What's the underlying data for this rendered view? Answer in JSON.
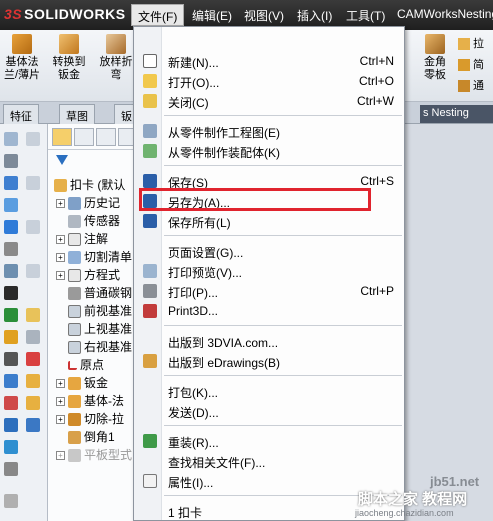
{
  "app": {
    "logo_text": "SOLIDWORKS"
  },
  "menubar": {
    "items": [
      {
        "label": "文件(F)"
      },
      {
        "label": "编辑(E)"
      },
      {
        "label": "视图(V)"
      },
      {
        "label": "插入(I)"
      },
      {
        "label": "工具(T)"
      },
      {
        "label": "CAMWorksNesting"
      }
    ]
  },
  "toolbar": {
    "buttons": [
      {
        "label_line1": "基体法",
        "label_line2": "兰/薄片",
        "icon": "base-flange-icon"
      },
      {
        "label_line1": "转换到",
        "label_line2": "钣金",
        "icon": "convert-sheetmetal-icon"
      },
      {
        "label_line1": "放样折",
        "label_line2": "弯",
        "icon": "lofted-bend-icon"
      }
    ],
    "right_buttons": [
      {
        "label_line1": "金角",
        "label_line2": "零板"
      },
      {
        "label": "拉"
      },
      {
        "label": "简"
      },
      {
        "label": "通"
      }
    ]
  },
  "tabs": {
    "items": [
      {
        "label": "特征"
      },
      {
        "label": "草图"
      },
      {
        "label": "钣"
      }
    ],
    "nesting_label": "s Nesting"
  },
  "tree": {
    "nodes": [
      {
        "label": "扣卡 (默认",
        "icon": "part-icon",
        "level": 0
      },
      {
        "label": "历史记",
        "icon": "history-icon",
        "level": 1
      },
      {
        "label": "传感器",
        "icon": "sensor-icon",
        "level": 1
      },
      {
        "label": "注解",
        "icon": "annotation-icon",
        "level": 1
      },
      {
        "label": "切割清单",
        "icon": "cutlist-icon",
        "level": 1
      },
      {
        "label": "方程式",
        "icon": "equation-icon",
        "level": 1
      },
      {
        "label": "普通碳钢",
        "icon": "material-icon",
        "level": 1
      },
      {
        "label": "前视基准",
        "icon": "plane-icon",
        "level": 1
      },
      {
        "label": "上视基准",
        "icon": "plane-icon",
        "level": 1
      },
      {
        "label": "右视基准",
        "icon": "plane-icon",
        "level": 1
      },
      {
        "label": "原点",
        "icon": "origin-icon",
        "level": 1
      },
      {
        "label": "钣金",
        "icon": "sheetmetal-icon",
        "level": 1
      },
      {
        "label": "基体-法",
        "icon": "feature-icon",
        "level": 1
      },
      {
        "label": "切除-拉",
        "icon": "cut-icon",
        "level": 1
      },
      {
        "label": "倒角1",
        "icon": "chamfer-icon",
        "level": 1
      },
      {
        "label": "平板型式",
        "icon": "flat-icon",
        "level": 1
      }
    ]
  },
  "file_menu": {
    "items": [
      {
        "label": "新建(N)...",
        "shortcut": "Ctrl+N",
        "icon": "new-icon"
      },
      {
        "label": "打开(O)...",
        "shortcut": "Ctrl+O",
        "icon": "open-icon"
      },
      {
        "label": "关闭(C)",
        "shortcut": "Ctrl+W",
        "icon": "close-icon"
      },
      {
        "label": "从零件制作工程图(E)",
        "shortcut": "",
        "icon": "make-drawing-icon"
      },
      {
        "label": "从零件制作装配体(K)",
        "shortcut": "",
        "icon": "make-assembly-icon"
      },
      {
        "label": "保存(S)",
        "shortcut": "Ctrl+S",
        "icon": "save-icon"
      },
      {
        "label": "另存为(A)...",
        "shortcut": "",
        "icon": "save-as-icon"
      },
      {
        "label": "保存所有(L)",
        "shortcut": "",
        "icon": "save-all-icon"
      },
      {
        "label": "页面设置(G)...",
        "shortcut": "",
        "icon": ""
      },
      {
        "label": "打印预览(V)...",
        "shortcut": "",
        "icon": "print-preview-icon"
      },
      {
        "label": "打印(P)...",
        "shortcut": "Ctrl+P",
        "icon": "print-icon"
      },
      {
        "label": "Print3D...",
        "shortcut": "",
        "icon": "print3d-icon"
      },
      {
        "label": "出版到 3DVIA.com...",
        "shortcut": "",
        "icon": ""
      },
      {
        "label": "出版到 eDrawings(B)",
        "shortcut": "",
        "icon": "edrawings-icon"
      },
      {
        "label": "打包(K)...",
        "shortcut": "",
        "icon": ""
      },
      {
        "label": "发送(D)...",
        "shortcut": "",
        "icon": ""
      },
      {
        "label": "重装(R)...",
        "shortcut": "",
        "icon": "reload-icon"
      },
      {
        "label": "查找相关文件(F)...",
        "shortcut": "",
        "icon": ""
      },
      {
        "label": "属性(I)...",
        "shortcut": "",
        "icon": "properties-icon"
      },
      {
        "label": "1 扣卡",
        "shortcut": "",
        "icon": ""
      }
    ],
    "highlighted_item": "另存为(A)..."
  },
  "watermark": {
    "line1": "jb51.net",
    "line2": "脚本之家 教程网",
    "line3": "jiaocheng.chazidian.com"
  },
  "colors": {
    "highlight_box": "#e0242e",
    "titlebar": "#2a2a2a",
    "nesting_tab": "#4a5566"
  }
}
